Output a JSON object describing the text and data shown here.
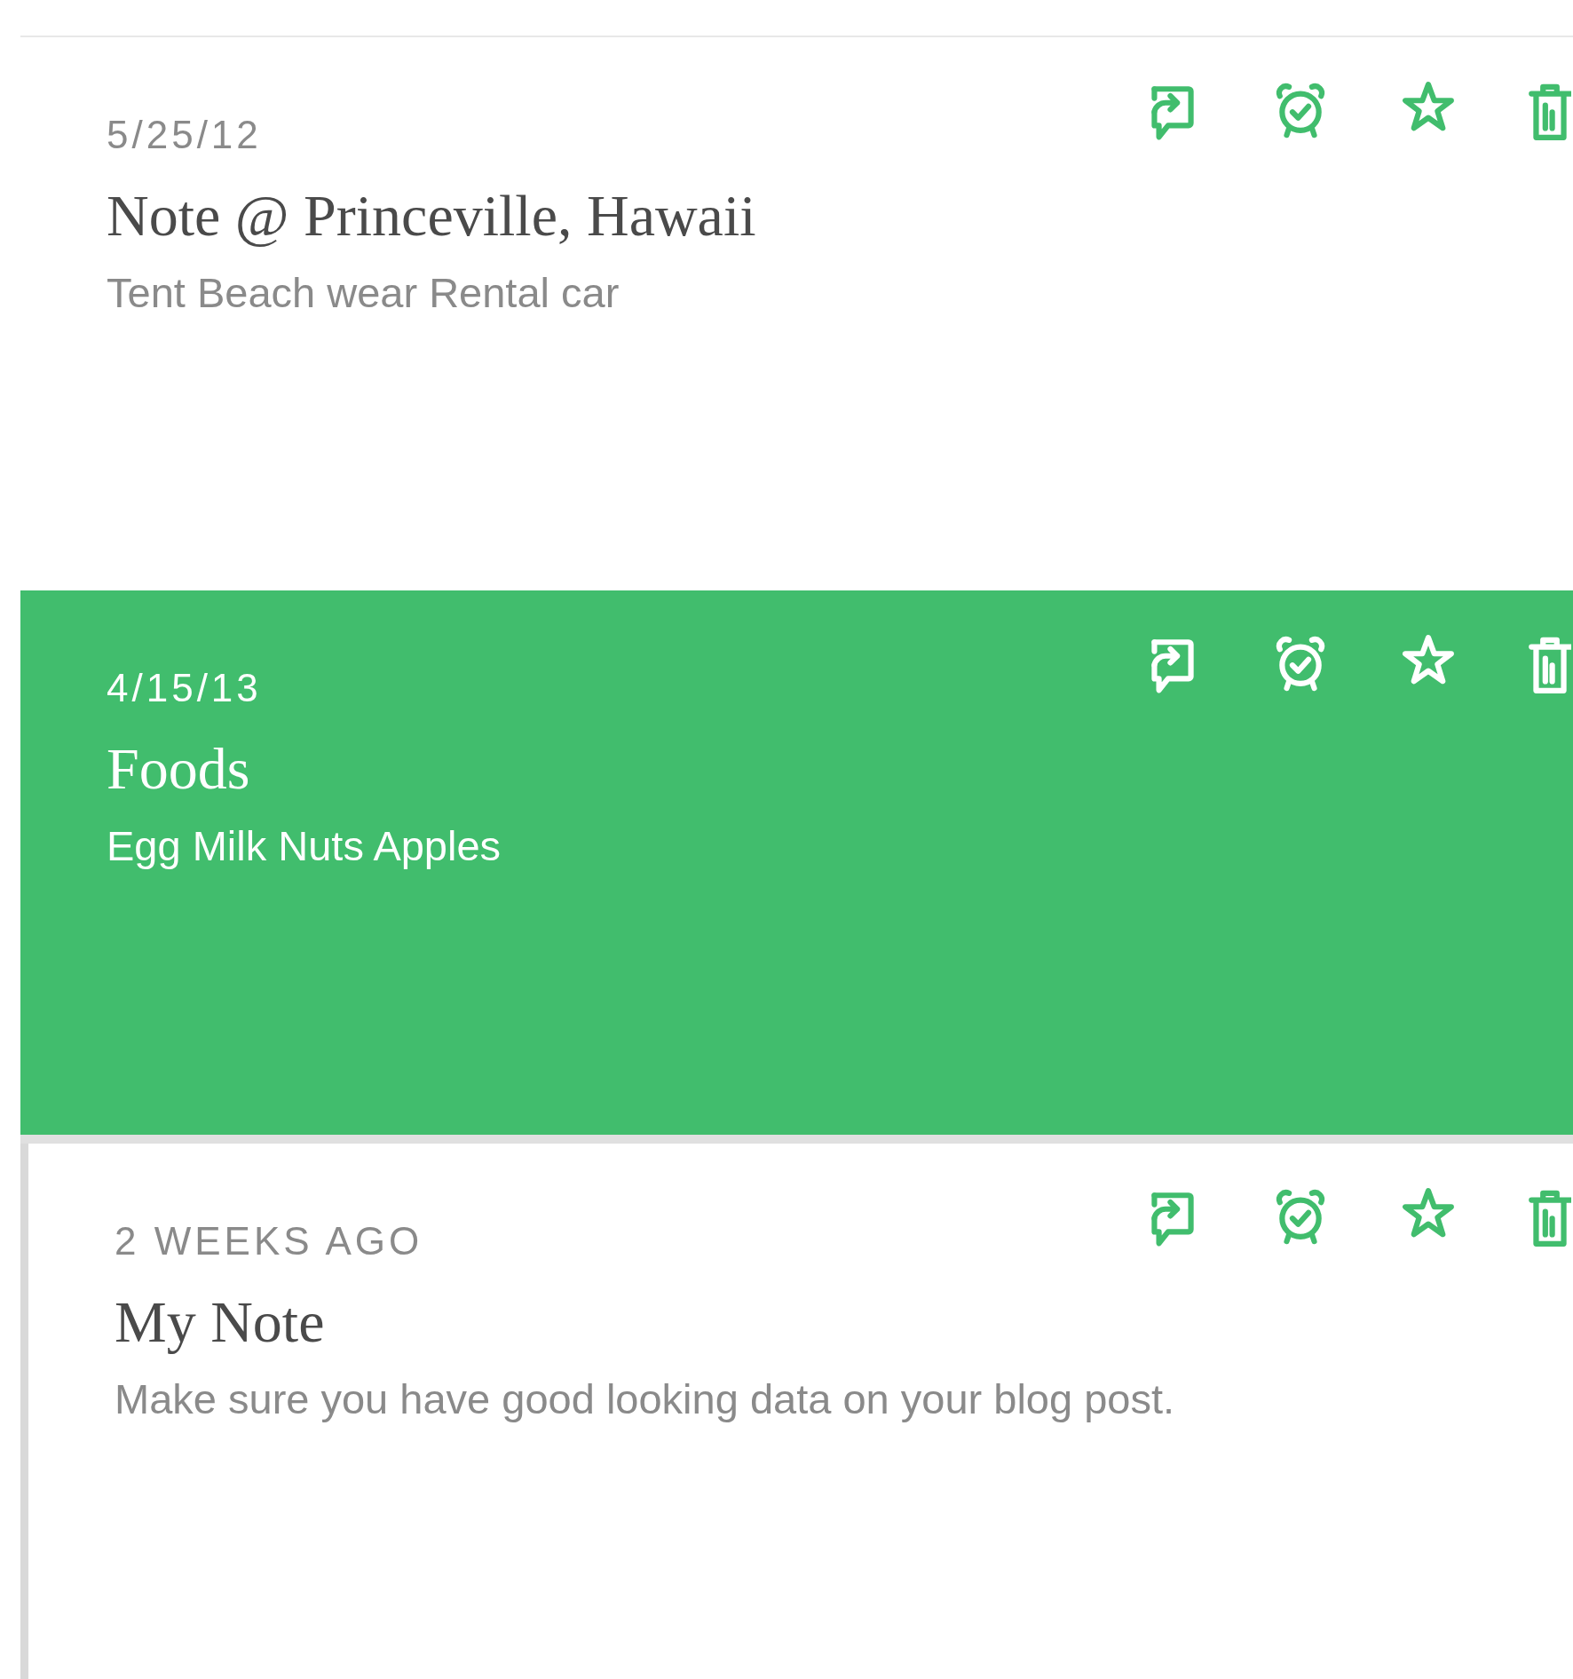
{
  "notes": [
    {
      "date": "5/25/12",
      "title": "Note @ Princeville, Hawaii",
      "snippet": "Tent Beach wear Rental car",
      "selected": false,
      "hovered": false
    },
    {
      "date": "4/15/13",
      "title": "Foods",
      "snippet": "Egg Milk Nuts Apples",
      "selected": true,
      "hovered": false
    },
    {
      "date": "2 WEEKS AGO",
      "title": "My Note",
      "snippet": "Make sure you have good looking data on your blog post.",
      "selected": false,
      "hovered": true
    }
  ]
}
